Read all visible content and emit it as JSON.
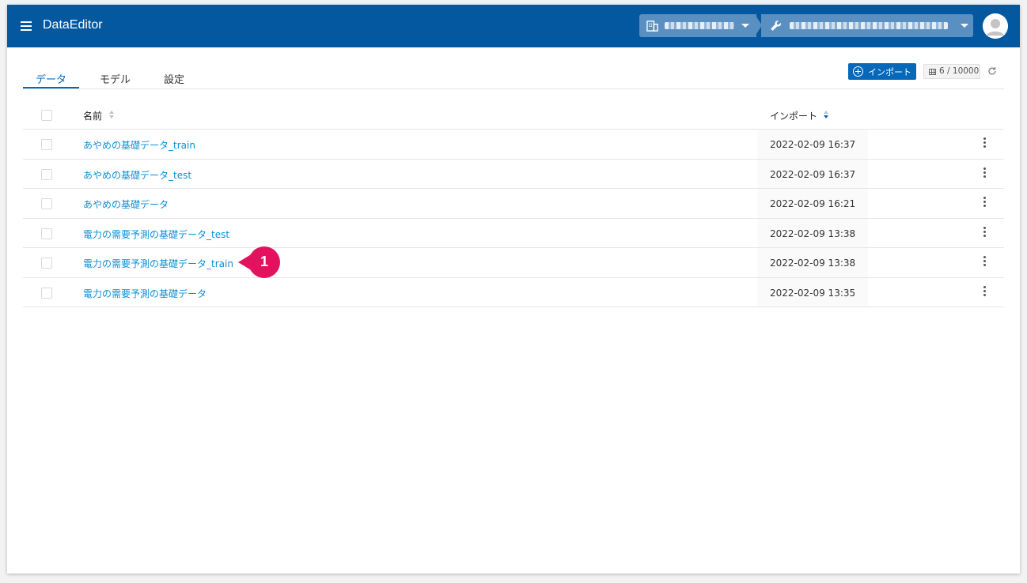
{
  "header": {
    "app_title": "DataEditor",
    "org_icon": "building-icon",
    "project_icon": "wrench-icon"
  },
  "tabs": [
    {
      "label": "データ",
      "active": true
    },
    {
      "label": "モデル",
      "active": false
    },
    {
      "label": "設定",
      "active": false
    }
  ],
  "toolbar": {
    "import_label": "インポート",
    "quota": "6 / 10000"
  },
  "table": {
    "columns": {
      "name": "名前",
      "import": "インポート"
    },
    "rows": [
      {
        "name": "あやめの基礎データ_train",
        "date": "2022-02-09 16:37"
      },
      {
        "name": "あやめの基礎データ_test",
        "date": "2022-02-09 16:37"
      },
      {
        "name": "あやめの基礎データ",
        "date": "2022-02-09 16:21"
      },
      {
        "name": "電力の需要予測の基礎データ_test",
        "date": "2022-02-09 13:38"
      },
      {
        "name": "電力の需要予測の基礎データ_train",
        "date": "2022-02-09 13:38"
      },
      {
        "name": "電力の需要予測の基礎データ",
        "date": "2022-02-09 13:35"
      }
    ]
  },
  "callout": {
    "number": "1",
    "color": "#e4115e"
  },
  "colors": {
    "header": "#0358a0",
    "accent": "#0368b8",
    "link": "#0a8fd6"
  }
}
